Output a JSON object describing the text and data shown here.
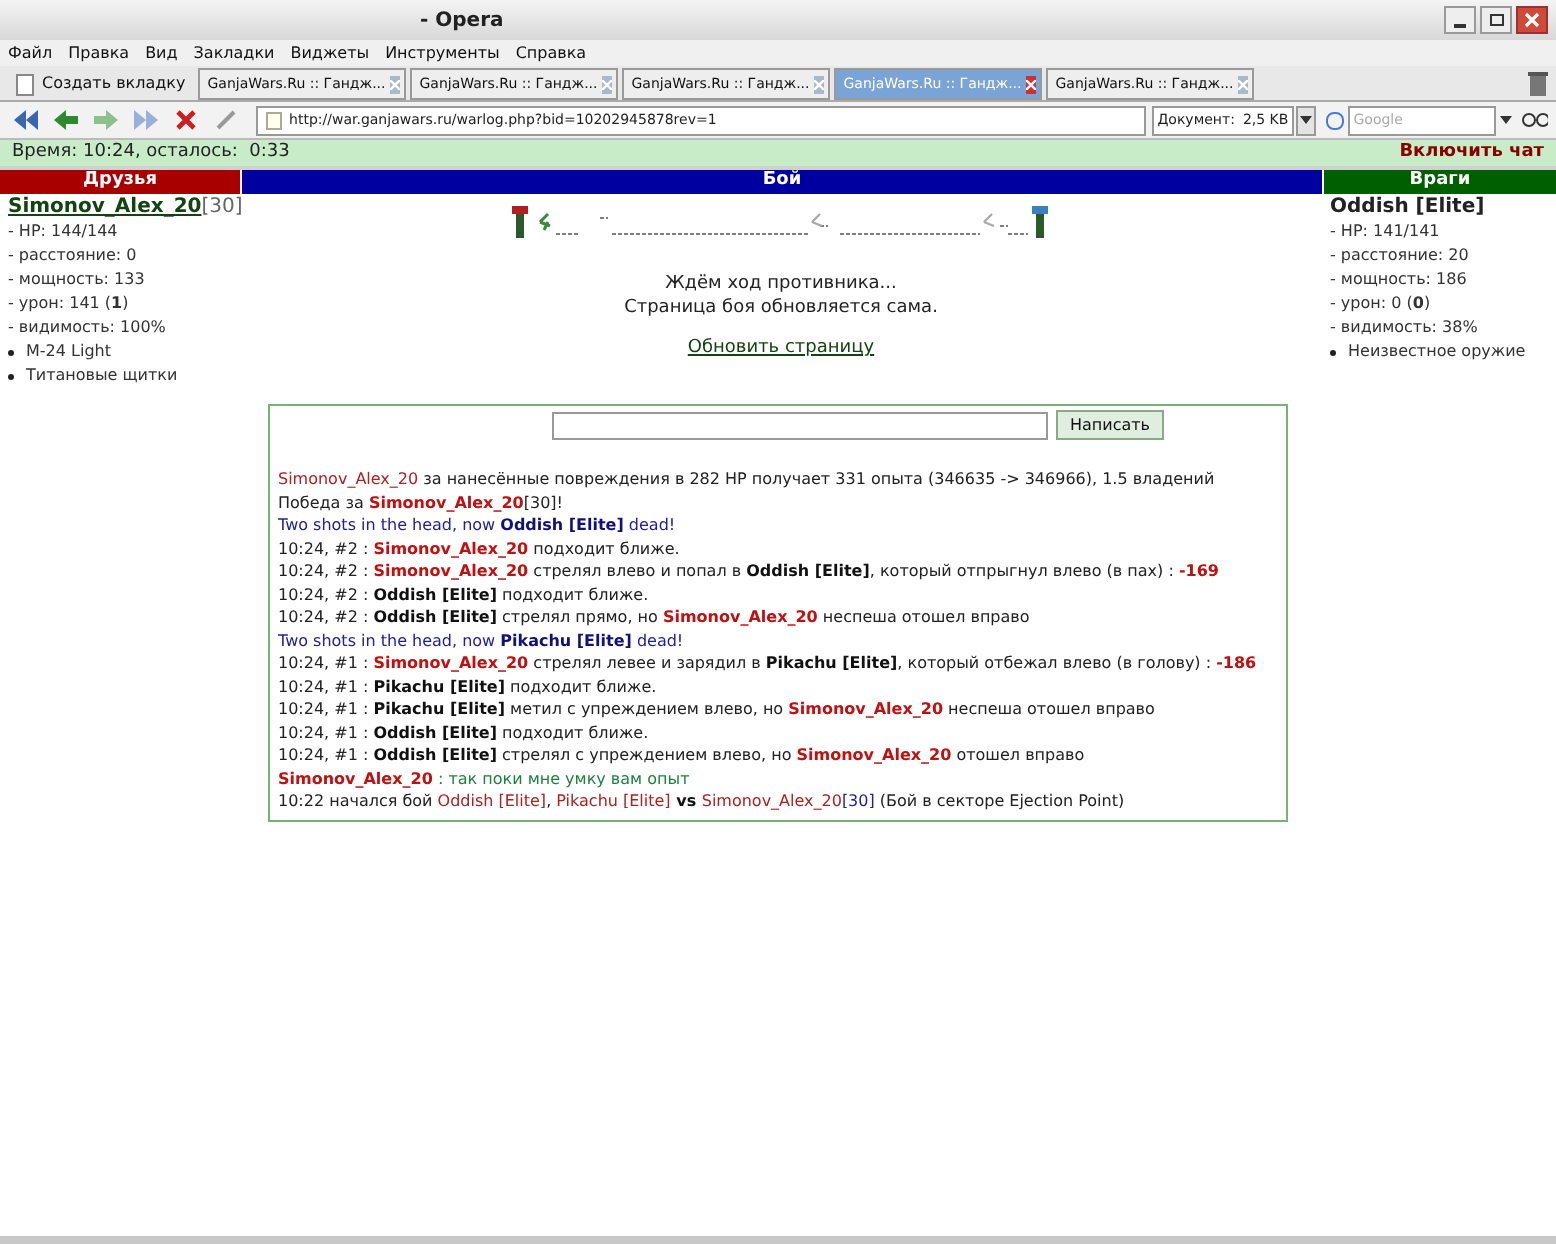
{
  "window": {
    "title": "- Opera"
  },
  "menu": [
    "Файл",
    "Правка",
    "Вид",
    "Закладки",
    "Виджеты",
    "Инструменты",
    "Справка"
  ],
  "new_tab": "Создать вкладку",
  "tabs": [
    {
      "label": "GanjaWars.Ru :: Гандж...",
      "selected": false
    },
    {
      "label": "GanjaWars.Ru :: Гандж...",
      "selected": false
    },
    {
      "label": "GanjaWars.Ru :: Гандж...",
      "selected": false
    },
    {
      "label": "GanjaWars.Ru :: Гандж...",
      "selected": true
    },
    {
      "label": "GanjaWars.Ru :: Гандж...",
      "selected": false
    }
  ],
  "address": "http://war.ganjawars.ru/warlog.php?bid=10202945878rev=1",
  "document_size": {
    "label": "Документ:",
    "value": "2,5 KB"
  },
  "search": {
    "placeholder": "Google"
  },
  "status": {
    "time": "Время: 10:24, осталось:  0:33",
    "chat": "Включить чат"
  },
  "headers": {
    "friends": "Друзья",
    "battle": "Бой",
    "enemies": "Враги"
  },
  "friend": {
    "name": "Simonov_Alex_20",
    "level": "[30]",
    "stats": [
      "- HP: 144/144",
      "- расстояние: 0",
      "- мощность: 133"
    ],
    "damage": {
      "prefix": "- урон: 141 (",
      "value": "1",
      "suffix": ")"
    },
    "visibility": "- видимость: 100%",
    "items": [
      "M-24 Light",
      "Титановые щитки"
    ]
  },
  "enemy": {
    "name": "Oddish [Elite]",
    "stats": [
      "- HP: 141/141",
      "- расстояние: 20",
      "- мощность: 186"
    ],
    "damage": {
      "prefix": "- урон: 0 (",
      "value": "0",
      "suffix": ")"
    },
    "visibility": "- видимость: 38%",
    "items": [
      "Неизвестное оружие"
    ]
  },
  "battle": {
    "waiting": "Ждём ход противника...",
    "auto_refresh": "Страница боя обновляется сама.",
    "refresh_link": "Обновить страницу"
  },
  "chat": {
    "button": "Написать"
  },
  "log": [
    [
      {
        "kind": "participant",
        "text": "Simonov_Alex_20"
      },
      {
        "kind": "text",
        "text": " за нанесённые повреждения в 282 HP получает 331 опыта (346635 -> 346966), 1.5 владений"
      }
    ],
    [
      {
        "kind": "text",
        "text": "Победа за "
      },
      {
        "kind": "player",
        "text": "Simonov_Alex_20"
      },
      {
        "kind": "text",
        "text": "[30]!"
      }
    ],
    [
      {
        "kind": "notice",
        "text": "Two shots in the head, now "
      },
      {
        "kind": "killed",
        "text": "Oddish [Elite]"
      },
      {
        "kind": "notice",
        "text": " dead!"
      }
    ],
    [
      {
        "kind": "text",
        "text": "10:24, #2 : "
      },
      {
        "kind": "player",
        "text": "Simonov_Alex_20"
      },
      {
        "kind": "text",
        "text": " подходит ближе."
      }
    ],
    [
      {
        "kind": "text",
        "text": "10:24, #2 : "
      },
      {
        "kind": "player",
        "text": "Simonov_Alex_20"
      },
      {
        "kind": "text",
        "text": " стрелял влево и попал в "
      },
      {
        "kind": "opponent",
        "text": "Oddish [Elite]"
      },
      {
        "kind": "text",
        "text": ", который отпрыгнул влево (в пах) : "
      },
      {
        "kind": "damage",
        "text": "-169"
      }
    ],
    [
      {
        "kind": "text",
        "text": "10:24, #2 : "
      },
      {
        "kind": "opponent",
        "text": "Oddish [Elite]"
      },
      {
        "kind": "text",
        "text": " подходит ближе."
      }
    ],
    [
      {
        "kind": "text",
        "text": "10:24, #2 : "
      },
      {
        "kind": "opponent",
        "text": "Oddish [Elite]"
      },
      {
        "kind": "text",
        "text": " стрелял прямо, но "
      },
      {
        "kind": "player",
        "text": "Simonov_Alex_20"
      },
      {
        "kind": "text",
        "text": " неспеша отошел вправо"
      }
    ],
    [
      {
        "kind": "notice",
        "text": "Two shots in the head, now "
      },
      {
        "kind": "killed",
        "text": "Pikachu [Elite]"
      },
      {
        "kind": "notice",
        "text": " dead!"
      }
    ],
    [
      {
        "kind": "text",
        "text": "10:24, #1 : "
      },
      {
        "kind": "player",
        "text": "Simonov_Alex_20"
      },
      {
        "kind": "text",
        "text": " стрелял левее и зарядил в "
      },
      {
        "kind": "opponent",
        "text": "Pikachu [Elite]"
      },
      {
        "kind": "text",
        "text": ", который отбежал влево (в голову) : "
      },
      {
        "kind": "damage",
        "text": "-186"
      }
    ],
    [
      {
        "kind": "text",
        "text": "10:24, #1 : "
      },
      {
        "kind": "opponent",
        "text": "Pikachu [Elite]"
      },
      {
        "kind": "text",
        "text": " подходит ближе."
      }
    ],
    [
      {
        "kind": "text",
        "text": "10:24, #1 : "
      },
      {
        "kind": "opponent",
        "text": "Pikachu [Elite]"
      },
      {
        "kind": "text",
        "text": " метил с упреждением влево, но "
      },
      {
        "kind": "player",
        "text": "Simonov_Alex_20"
      },
      {
        "kind": "text",
        "text": " неспеша отошел вправо"
      }
    ],
    [
      {
        "kind": "text",
        "text": "10:24, #1 : "
      },
      {
        "kind": "opponent",
        "text": "Oddish [Elite]"
      },
      {
        "kind": "text",
        "text": " подходит ближе."
      }
    ],
    [
      {
        "kind": "text",
        "text": "10:24, #1 : "
      },
      {
        "kind": "opponent",
        "text": "Oddish [Elite]"
      },
      {
        "kind": "text",
        "text": " стрелял с упреждением влево, но "
      },
      {
        "kind": "player",
        "text": "Simonov_Alex_20"
      },
      {
        "kind": "text",
        "text": " отошел вправо"
      }
    ],
    [
      {
        "kind": "player",
        "text": "Simonov_Alex_20"
      },
      {
        "kind": "chat",
        "text": " : так поки мне умку вам опыт"
      }
    ],
    [
      {
        "kind": "text",
        "text": "10:22 начался бой "
      },
      {
        "kind": "participant",
        "text": "Oddish [Elite]"
      },
      {
        "kind": "text",
        "text": ", "
      },
      {
        "kind": "participant",
        "text": "Pikachu [Elite]"
      },
      {
        "kind": "versus",
        "text": " vs "
      },
      {
        "kind": "participant",
        "text": "Simonov_Alex_20"
      },
      {
        "kind": "level",
        "text": "[30]"
      },
      {
        "kind": "text",
        "text": " (Бой в секторе Ejection Point)"
      }
    ]
  ]
}
